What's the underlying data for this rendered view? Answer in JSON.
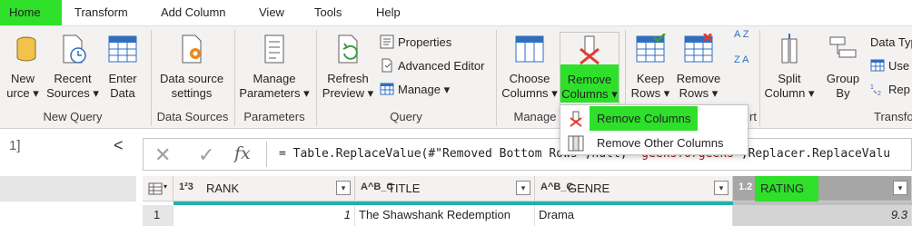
{
  "tabs": [
    {
      "label": "Home",
      "active": true
    },
    {
      "label": "Transform",
      "active": false
    },
    {
      "label": "Add Column",
      "active": false
    },
    {
      "label": "View",
      "active": false
    },
    {
      "label": "Tools",
      "active": false
    },
    {
      "label": "Help",
      "active": false
    }
  ],
  "ribbon": {
    "new_query": {
      "group_label": "New Query",
      "new_source": {
        "line1": "New",
        "line2": "urce"
      },
      "recent_sources": {
        "line1": "Recent",
        "line2": "Sources"
      },
      "enter_data": {
        "line1": "Enter",
        "line2": "Data"
      }
    },
    "data_sources": {
      "group_label": "Data Sources",
      "data_source_settings": {
        "line1": "Data source",
        "line2": "settings"
      }
    },
    "parameters": {
      "group_label": "Parameters",
      "manage_parameters": {
        "line1": "Manage",
        "line2": "Parameters"
      }
    },
    "query": {
      "group_label": "Query",
      "refresh_preview": {
        "line1": "Refresh",
        "line2": "Preview"
      },
      "properties": "Properties",
      "advanced_editor": "Advanced Editor",
      "manage": "Manage"
    },
    "manage_columns": {
      "group_label": "Manage",
      "choose_columns": {
        "line1": "Choose",
        "line2": "Columns"
      },
      "remove_columns": {
        "line1": "Remove",
        "line2": "Columns"
      }
    },
    "reduce_rows": {
      "keep_rows": {
        "line1": "Keep",
        "line2": "Rows"
      },
      "remove_rows": {
        "line1": "Remove",
        "line2": "Rows"
      },
      "group_label_fragment": "rt"
    },
    "sort": {
      "az": "A Z",
      "za": "Z A"
    },
    "transform": {
      "group_label": "Transfo",
      "split_column": {
        "line1": "Split",
        "line2": "Column"
      },
      "group_by": {
        "line1": "Group",
        "line2": "By"
      },
      "data_type": "Data Typ",
      "use_first_row": "Use",
      "replace_values": "Rep"
    }
  },
  "dropdown_menu": {
    "items": [
      {
        "label": "Remove Columns",
        "highlighted": true
      },
      {
        "label": "Remove Other Columns",
        "highlighted": false
      }
    ]
  },
  "query_pane": {
    "count_text": "1]",
    "collapse_glyph": "<"
  },
  "formula_bar": {
    "cancel_glyph": "✕",
    "commit_glyph": "✓",
    "fx_label": "fx",
    "formula_prefix": "= Table.ReplaceValue(#\"Removed Bottom Rows\",",
    "formula_null": "null",
    "formula_comma": ", ",
    "formula_string": "\"geeksforgeeks\"",
    "formula_suffix": ",Replacer.ReplaceValu"
  },
  "table": {
    "columns": [
      {
        "type_icon": "1²3",
        "name": "RANK"
      },
      {
        "type_icon": "A^B_C",
        "name": "TITLE"
      },
      {
        "type_icon": "A^B_C",
        "name": "GENRE"
      },
      {
        "type_icon": "1.2",
        "name": "RATING"
      }
    ],
    "rows": [
      {
        "index": "1",
        "rank": "1",
        "title": "The Shawshank Redemption",
        "genre": "Drama",
        "rating": "9.3"
      }
    ]
  },
  "colors": {
    "highlight_green": "#2ee02a",
    "quality_bar": "#1fb3a8",
    "remove_red": "#e23b2e",
    "icon_blue": "#2f6fbf"
  }
}
